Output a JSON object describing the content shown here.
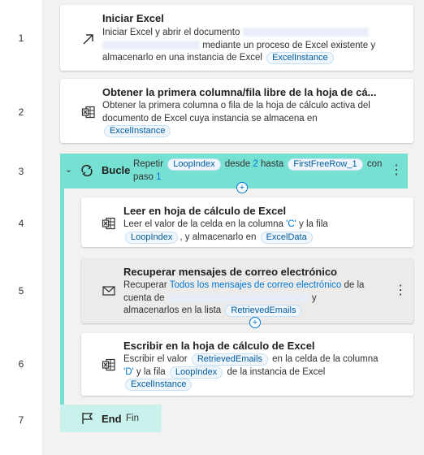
{
  "line_numbers": [
    "1",
    "2",
    "3",
    "4",
    "5",
    "6",
    "7"
  ],
  "actions": {
    "a1": {
      "title": "Iniciar Excel",
      "desc1": "Iniciar Excel y abrir el documento",
      "desc2": "mediante un proceso de Excel existente y",
      "desc3": "almacenarlo en una instancia de Excel",
      "chip": "ExcelInstance"
    },
    "a2": {
      "title": "Obtener la primera columna/fila libre de la hoja de cá...",
      "desc1": "Obtener la primera columna o fila de la hoja de cálculo activa del",
      "desc2": "documento de Excel cuya instancia se almacena en",
      "chip": "ExcelInstance"
    },
    "loop": {
      "label": "Bucle",
      "t1": "Repetir",
      "chip1": "LoopIndex",
      "t2": "desde",
      "from": "2",
      "t3": "hasta",
      "chip2": "FirstFreeRow_1",
      "t4": "con",
      "t5": "paso",
      "step": "1"
    },
    "a4": {
      "title": "Leer en hoja de cálculo de Excel",
      "desc1": "Leer el valor de la celda en la columna",
      "col": "'C'",
      "desc2": "y la fila",
      "chip1": "LoopIndex",
      "desc3": ", y almacenarlo en",
      "chip2": "ExcelData"
    },
    "a5": {
      "title": "Recuperar mensajes de correo electrónico",
      "t1": "Recuperar",
      "link": "Todos los mensajes de correo electrónico",
      "t2": "de la",
      "t3": "cuenta de",
      "t4": "y",
      "t5": "almacenarlos en la lista",
      "chip": "RetrievedEmails"
    },
    "a6": {
      "title": "Escribir en la hoja de cálculo de Excel",
      "t1": "Escribir el valor",
      "chip1": "RetrievedEmails",
      "t2": "en la celda de la columna",
      "col": "'D'",
      "t3": "y la fila",
      "chip2": "LoopIndex",
      "t4": "de la instancia de Excel",
      "chip3": "ExcelInstance"
    },
    "end": {
      "label": "End",
      "sub": "Fin"
    }
  }
}
